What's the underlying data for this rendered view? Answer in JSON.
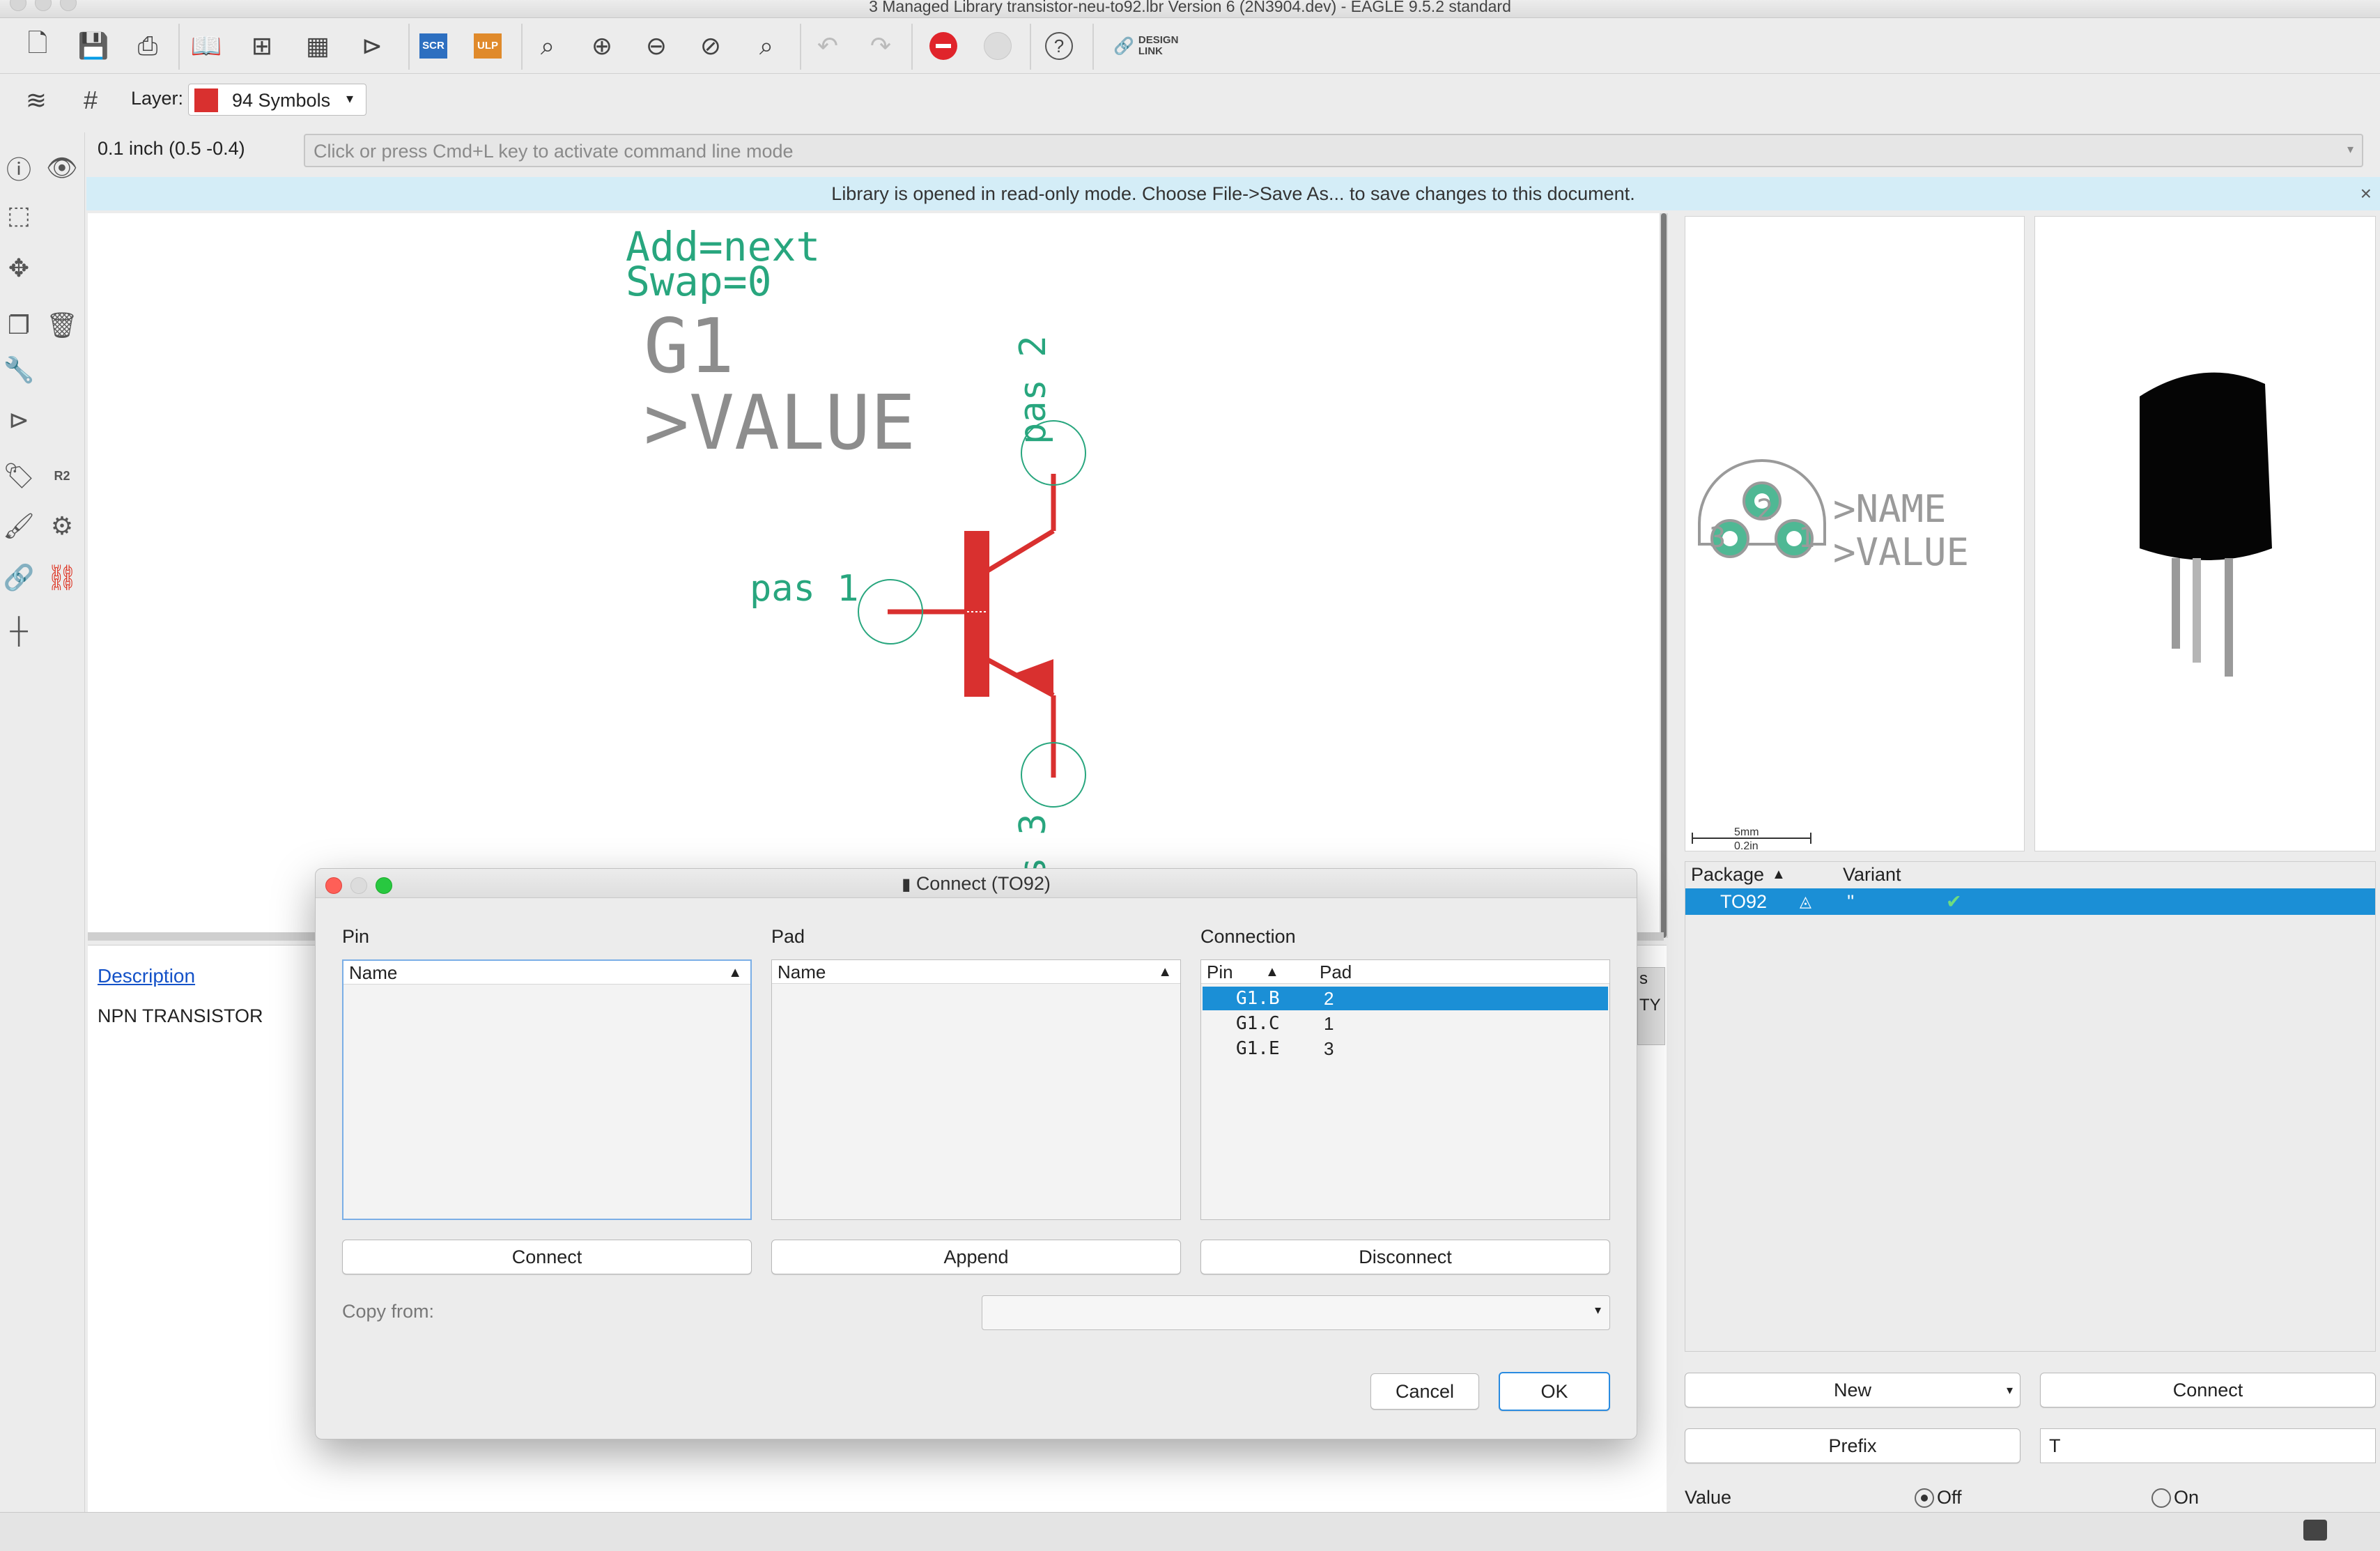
{
  "window": {
    "title": "3 Managed Library transistor-neu-to92.lbr Version 6 (2N3904.dev) - EAGLE 9.5.2 standard"
  },
  "toolbar": {
    "scr_label": "SCR",
    "ulp_label": "ULP",
    "design_link_label": "DESIGN LINK",
    "help_label": "?"
  },
  "layer_bar": {
    "layer_label": "Layer:",
    "layer_value": "94 Symbols",
    "layer_color": "#d9302f"
  },
  "command": {
    "grid_readout": "0.1 inch (0.5 -0.4)",
    "placeholder": "Click or press Cmd+L key to activate command line mode"
  },
  "banner": {
    "text": "Library is opened in read-only mode. Choose File->Save As... to save changes to this document.",
    "close": "×"
  },
  "schematic": {
    "add_text": "Add=next",
    "swap_text": "Swap=0",
    "name_text": "G1",
    "value_text": ">VALUE",
    "pin1_label": "pas 1",
    "pin2_label": "pas 2",
    "pin3_label": "pas 3",
    "symbol_color": "#d9302f",
    "pin_color": "#28a67e",
    "text_color": "#8d8d8d"
  },
  "description": {
    "link": "Description",
    "text": "NPN TRANSISTOR"
  },
  "package_preview": {
    "name_text": ">NAME",
    "value_text": ">VALUE",
    "pad_labels": [
      "2",
      "3",
      "1"
    ],
    "scale_mm": "5mm",
    "scale_in": "0.2in"
  },
  "package_list": {
    "headers": {
      "package": "Package",
      "variant": "Variant"
    },
    "rows": [
      {
        "package": "TO92",
        "variant": "''"
      }
    ]
  },
  "right_buttons": {
    "new": "New",
    "connect": "Connect",
    "prefix": "Prefix",
    "prefix_value": "T"
  },
  "value_row": {
    "label": "Value",
    "off": "Off",
    "on": "On"
  },
  "dialog": {
    "title": "Connect  (TO92)",
    "pin_heading": "Pin",
    "pad_heading": "Pad",
    "connection_heading": "Connection",
    "name_col": "Name",
    "conn_pin_col": "Pin",
    "conn_pad_col": "Pad",
    "connections": [
      {
        "pin": "G1.B",
        "pad": "2"
      },
      {
        "pin": "G1.C",
        "pad": "1"
      },
      {
        "pin": "G1.E",
        "pad": "3"
      }
    ],
    "connect_button": "Connect",
    "append_button": "Append",
    "disconnect_button": "Disconnect",
    "copy_from_label": "Copy from:",
    "cancel_button": "Cancel",
    "ok_button": "OK"
  },
  "side_tabs": [
    "s",
    "TY"
  ]
}
